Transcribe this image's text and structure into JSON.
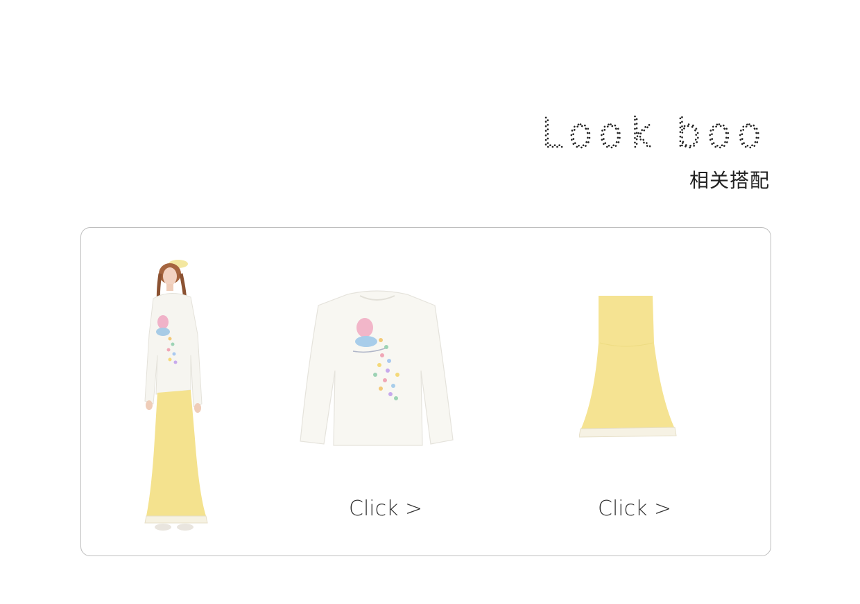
{
  "header": {
    "title": "Look book",
    "subtitle": "相关搭配"
  },
  "lookbook": {
    "items": [
      {
        "name": "model-outfit",
        "link_label": ""
      },
      {
        "name": "white-long-sleeve-top",
        "link_label": "Click >"
      },
      {
        "name": "yellow-mermaid-skirt",
        "link_label": "Click >"
      }
    ]
  },
  "colors": {
    "card_border": "#bdbdbd",
    "skirt_yellow": "#f4e28e",
    "top_white": "#f7f6f1",
    "text": "#333333"
  }
}
